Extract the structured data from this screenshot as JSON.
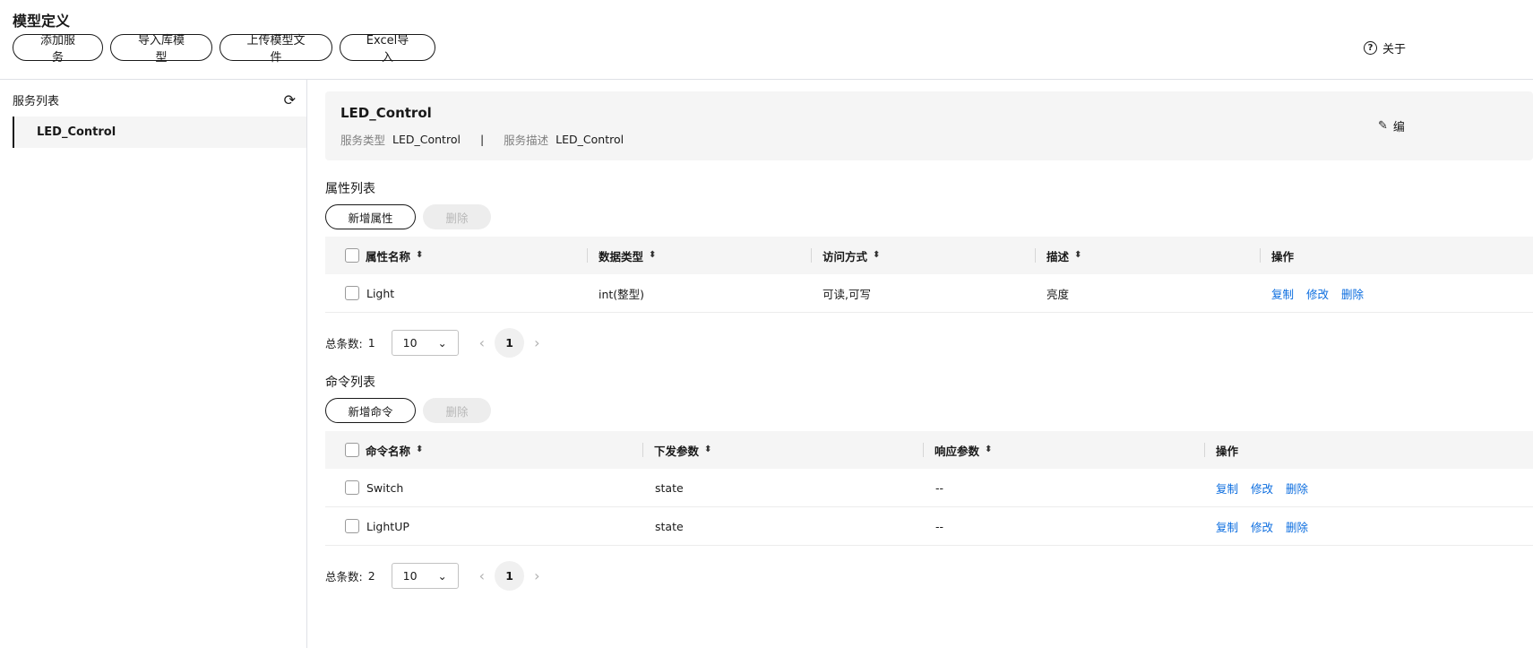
{
  "header": {
    "title": "模型定义",
    "buttons": [
      "添加服务",
      "导入库模型",
      "上传模型文件",
      "Excel导入"
    ],
    "about_label": "关于"
  },
  "sidebar": {
    "title": "服务列表",
    "items": [
      {
        "label": "LED_Control"
      }
    ]
  },
  "service_card": {
    "name": "LED_Control",
    "type_label": "服务类型",
    "type_value": "LED_Control",
    "separator": "|",
    "desc_label": "服务描述",
    "desc_value": "LED_Control",
    "edit_label": "编"
  },
  "attributes": {
    "title": "属性列表",
    "add_label": "新增属性",
    "delete_label": "删除",
    "columns": [
      "属性名称",
      "数据类型",
      "访问方式",
      "描述",
      "操作"
    ],
    "rows": [
      {
        "name": "Light",
        "type": "int(整型)",
        "access": "可读,可写",
        "desc": "亮度"
      }
    ],
    "row_actions": [
      "复制",
      "修改",
      "删除"
    ],
    "pager": {
      "total_label": "总条数:",
      "total": "1",
      "page_size": "10",
      "page": "1"
    }
  },
  "commands": {
    "title": "命令列表",
    "add_label": "新增命令",
    "delete_label": "删除",
    "columns": [
      "命令名称",
      "下发参数",
      "响应参数",
      "操作"
    ],
    "rows": [
      {
        "name": "Switch",
        "params": "state",
        "response": "--"
      },
      {
        "name": "LightUP",
        "params": "state",
        "response": "--"
      }
    ],
    "row_actions": [
      "复制",
      "修改",
      "删除"
    ],
    "pager": {
      "total_label": "总条数:",
      "total": "2",
      "page_size": "10",
      "page": "1"
    }
  },
  "colors": {
    "link": "#0a6cdf",
    "panel_bg": "#f5f5f5",
    "text": "#191919"
  }
}
